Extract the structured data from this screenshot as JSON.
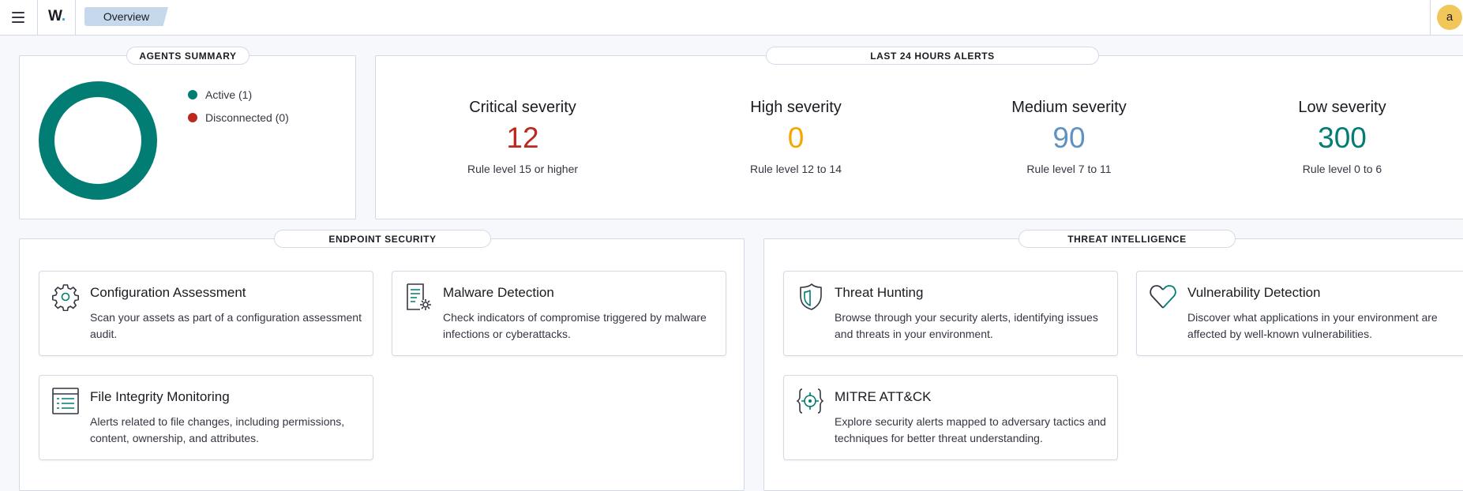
{
  "header": {
    "logo_text": "W",
    "logo_dot": ".",
    "breadcrumb": "Overview",
    "avatar_initial": "a"
  },
  "agents_summary": {
    "title": "AGENTS SUMMARY",
    "legend": [
      {
        "label": "Active (1)",
        "color": "#017d73"
      },
      {
        "label": "Disconnected (0)",
        "color": "#bd271e"
      }
    ],
    "donut_color": "#017d73"
  },
  "alerts": {
    "title": "LAST 24 HOURS ALERTS",
    "items": [
      {
        "title": "Critical severity",
        "count": "12",
        "desc": "Rule level 15 or higher",
        "color": "#bd271e"
      },
      {
        "title": "High severity",
        "count": "0",
        "desc": "Rule level 12 to 14",
        "color": "#f5a700"
      },
      {
        "title": "Medium severity",
        "count": "90",
        "desc": "Rule level 7 to 11",
        "color": "#6092c0"
      },
      {
        "title": "Low severity",
        "count": "300",
        "desc": "Rule level 0 to 6",
        "color": "#017d73"
      }
    ]
  },
  "endpoint_security": {
    "title": "ENDPOINT SECURITY",
    "cards": [
      {
        "title": "Configuration Assessment",
        "desc": "Scan your assets as part of a configuration assessment audit.",
        "icon": "gear-icon"
      },
      {
        "title": "Malware Detection",
        "desc": "Check indicators of compromise triggered by malware infections or cyberattacks.",
        "icon": "document-gear-icon"
      },
      {
        "title": "File Integrity Monitoring",
        "desc": "Alerts related to file changes, including permissions, content, ownership, and attributes.",
        "icon": "list-document-icon"
      }
    ]
  },
  "threat_intelligence": {
    "title": "THREAT INTELLIGENCE",
    "cards": [
      {
        "title": "Threat Hunting",
        "desc": "Browse through your security alerts, identifying issues and threats in your environment.",
        "icon": "shield-icon"
      },
      {
        "title": "Vulnerability Detection",
        "desc": "Discover what applications in your environment are affected by well-known vulnerabilities.",
        "icon": "heart-icon"
      },
      {
        "title": "MITRE ATT&CK",
        "desc": "Explore security alerts mapped to adversary tactics and techniques for better threat understanding.",
        "icon": "crosshair-icon"
      }
    ]
  }
}
